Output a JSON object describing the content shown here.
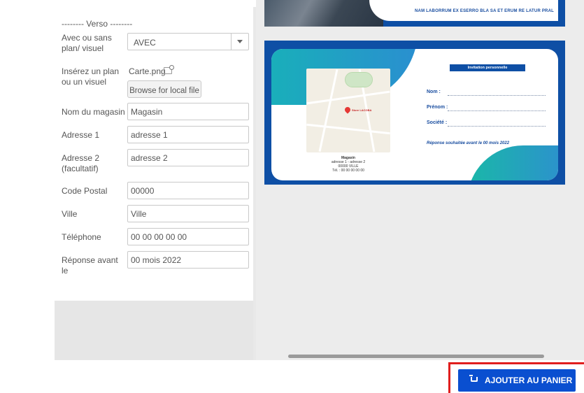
{
  "form": {
    "section_title": "-------- Verso --------",
    "plan": {
      "label": "Avec ou sans plan/ visuel",
      "value": "AVEC"
    },
    "visual": {
      "label": "Insérez un plan ou un visuel",
      "file_name": "Carte.png",
      "browse_label": "Browse for local file"
    },
    "store_name": {
      "label": "Nom du magasin",
      "value": "Magasin"
    },
    "address1": {
      "label": "Adresse 1",
      "value": "adresse 1"
    },
    "address2": {
      "label": "Adresse 2 (facultatif)",
      "value": "adresse 2"
    },
    "postal_code": {
      "label": "Code Postal",
      "value": "00000"
    },
    "city": {
      "label": "Ville",
      "value": "Ville"
    },
    "phone": {
      "label": "Téléphone",
      "value": "00 00 00 00 00"
    },
    "reply_by": {
      "label": "Réponse avant le",
      "value": "00 mois 2022"
    }
  },
  "preview": {
    "top_banner_text": "NAM LABORRUM EX ESERRO BLA SA ET ERUM RE LATUR PRAL",
    "invitation_title": "Invitation personnelle",
    "lines": [
      "Nom :",
      "Prénom :",
      "Société :"
    ],
    "reply_text": "Réponse souhaitée avant le 00 mois 2022",
    "map_pin_label": "Store LACOBA",
    "store_info": {
      "name": "Magasin",
      "address": "adresse 1 - adresse 2",
      "city": "00000 VILLE",
      "phone": "Tél. : 00 00 00 00 00"
    }
  },
  "actions": {
    "add_to_cart": "AJOUTER AU PANIER"
  },
  "colors": {
    "primary": "#0a4fd0",
    "highlight": "#e01e1e",
    "card_blue": "#0e4fa5",
    "teal": "#17b3b7"
  }
}
